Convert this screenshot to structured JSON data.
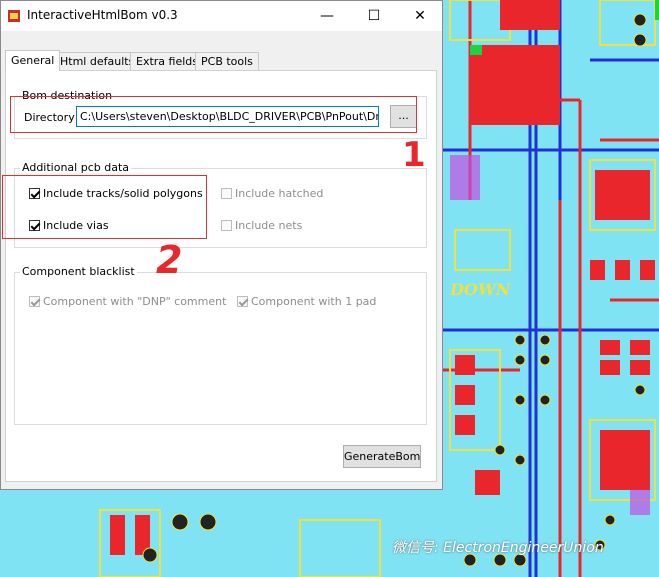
{
  "window": {
    "title": "InteractiveHtmlBom v0.3",
    "controls": {
      "minimize": "—",
      "maximize": "☐",
      "close": "✕"
    }
  },
  "tabs": [
    "General",
    "Html defaults",
    "Extra fields",
    "PCB tools"
  ],
  "active_tab": "General",
  "bom_destination": {
    "label": "Bom destination",
    "directory_label": "Directory",
    "directory_value": "C:\\Users\\steven\\Desktop\\BLDC_DRIVER\\PCB\\PnPout\\DriverPc",
    "browse_label": "..."
  },
  "additional_pcb_data": {
    "label": "Additional pcb data",
    "include_tracks": {
      "label": "Include tracks/solid polygons",
      "checked": true
    },
    "include_vias": {
      "label": "Include vias",
      "checked": true
    },
    "include_hatched": {
      "label": "Include hatched",
      "checked": false
    },
    "include_nets": {
      "label": "Include nets",
      "checked": false
    }
  },
  "component_blacklist": {
    "label": "Component blacklist",
    "dnp_comment": {
      "label": "Component with \"DNP\" comment",
      "checked": true
    },
    "one_pad": {
      "label": "Component with 1 pad",
      "checked": true
    }
  },
  "generate_button": "GenerateBom",
  "annotations": {
    "mark_1": "1",
    "mark_2": "2"
  },
  "pcb_text": "DOWN",
  "watermark": "微信号: ElectronEngineerUnion",
  "colors": {
    "pcb_background": "#7fe3f3",
    "pad_red": "#e8262c",
    "trace_blue": "#2030d8",
    "silk_yellow": "#f0e040",
    "annotation_red": "#e8262c"
  }
}
